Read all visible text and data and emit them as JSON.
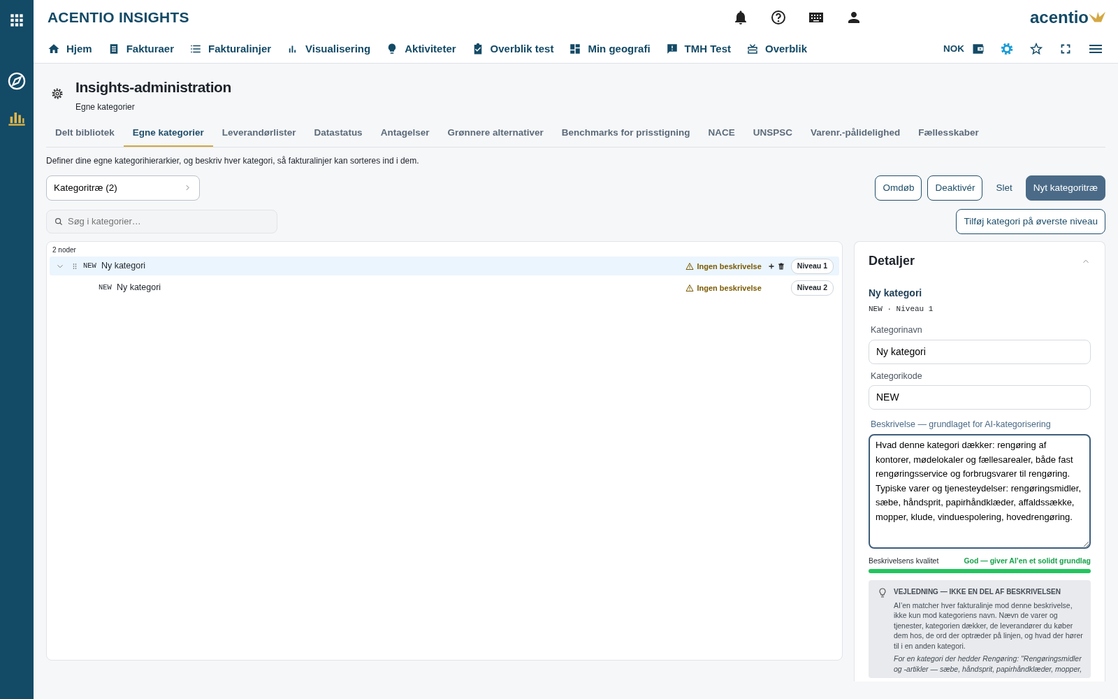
{
  "sidebar": {
    "items": [
      {
        "kind": "compass",
        "selected": false
      },
      {
        "kind": "chart",
        "selected": true
      }
    ]
  },
  "header": {
    "app_title": "ACENTIO INSIGHTS",
    "logo": "acentio",
    "currency": "NOK"
  },
  "nav": [
    {
      "label": "Hjem",
      "kind": "home"
    },
    {
      "label": "Fakturaer",
      "kind": "receipt"
    },
    {
      "label": "Fakturalinjer",
      "kind": "list"
    },
    {
      "label": "Visualisering",
      "kind": "bars"
    },
    {
      "label": "Aktiviteter",
      "kind": "bulb"
    },
    {
      "label": "Overblik test",
      "kind": "clipboard"
    },
    {
      "label": "Min geografi",
      "kind": "dashboard"
    },
    {
      "label": "TMH Test",
      "kind": "feedback"
    },
    {
      "label": "Overblik",
      "kind": "gift"
    }
  ],
  "page": {
    "title": "Insights-administration",
    "subtitle": "Egne kategorier"
  },
  "tabs": [
    {
      "label": "Delt bibliotek",
      "selected": false
    },
    {
      "label": "Egne kategorier",
      "selected": true
    },
    {
      "label": "Leverandørlister",
      "selected": false
    },
    {
      "label": "Datastatus",
      "selected": false
    },
    {
      "label": "Antagelser",
      "selected": false
    },
    {
      "label": "Grønnere alternativer",
      "selected": false
    },
    {
      "label": "Benchmarks for prisstigning",
      "selected": false
    },
    {
      "label": "NACE",
      "selected": false
    },
    {
      "label": "UNSPSC",
      "selected": false
    },
    {
      "label": "Varenr.-pålidelighed",
      "selected": false
    },
    {
      "label": "Fællesskaber",
      "selected": false
    }
  ],
  "intro": "Definer dine egne kategorihierarkier, og beskriv hver kategori, så fakturalinjer kan sorteres ind i dem.",
  "tree_selector": "Kategoritræ (2)",
  "actions": [
    {
      "label": "Omdøb",
      "kind": "outline"
    },
    {
      "label": "Deaktivér",
      "kind": "outline"
    },
    {
      "label": "Slet",
      "kind": "plain"
    },
    {
      "label": "Nyt kategoritræ",
      "kind": "primary"
    }
  ],
  "search": {
    "placeholder": "Søg i kategorier…"
  },
  "add_top_button": "Tilføj kategori på øverste niveau",
  "tree": {
    "count": "2 noder",
    "nodes": [
      {
        "code": "NEW",
        "name": "Ny kategori",
        "warning": "Ingen beskrivelse",
        "level_badge": "Niveau 1",
        "selected": true,
        "expanded": true,
        "children": [
          {
            "code": "NEW",
            "name": "Ny kategori",
            "warning": "Ingen beskrivelse",
            "level_badge": "Niveau 2",
            "selected": false
          }
        ]
      }
    ]
  },
  "details": {
    "title": "Detaljer",
    "expanded": true,
    "name": "Ny kategori",
    "meta": "NEW · Niveau 1",
    "fields": [
      {
        "label": "Kategorinavn",
        "value": "Ny kategori"
      },
      {
        "label": "Kategorikode",
        "value": "NEW"
      }
    ],
    "description": {
      "label": "Beskrivelse — grundlaget for AI-kategorisering",
      "value": "Hvad denne kategori dækker: rengøring af kontorer, mødelokaler og fællesarealer, både fast rengøringsservice og forbrugsvarer til rengøring. Typiske varer og tjenesteydelser: rengøringsmidler, sæbe, håndsprit, papirhåndklæder, affaldssække, mopper, klude, vinduespolering, hovedrengøring.",
      "focused": true
    },
    "quality": {
      "label": "Beskrivelsens kvalitet",
      "reading": "God — giver AI’en et solidt grundlag",
      "level": 1.0
    },
    "guide": {
      "title": "VEJLEDNING — IKKE EN DEL AF BESKRIVELSEN",
      "text": "AI’en matcher hver fakturalinje mod denne beskrivelse, ikke kun mod kategoriens navn. Nævn de varer og tjenester, kategorien dækker, de leverandører du køber dem hos, de ord der optræder på linjen, og hvad der hører til i en anden kategori.",
      "example": "For en kategori der hedder Rengøring: \"Rengøringsmidler og -artikler — sæbe, håndsprit, papirhåndklæder, mopper,"
    }
  }
}
